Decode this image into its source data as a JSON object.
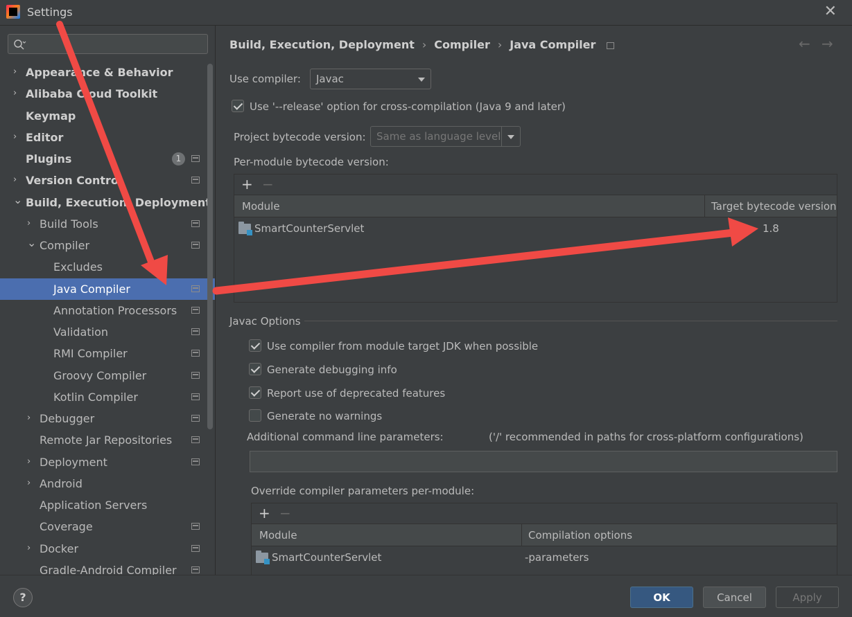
{
  "window": {
    "title": "Settings",
    "close_icon": "close-icon"
  },
  "sidebar": {
    "search_placeholder": "",
    "items": [
      {
        "label": "Appearance & Behavior",
        "bold": true,
        "arrow": "›"
      },
      {
        "label": "Alibaba Cloud Toolkit",
        "bold": true,
        "arrow": "›"
      },
      {
        "label": "Keymap",
        "bold": true,
        "arrow": ""
      },
      {
        "label": "Editor",
        "bold": true,
        "arrow": "›"
      },
      {
        "label": "Plugins",
        "bold": true,
        "arrow": "",
        "badge": "1"
      },
      {
        "label": "Version Control",
        "bold": true,
        "arrow": "›"
      },
      {
        "label": "Build, Execution, Deployment",
        "bold": true,
        "arrow": "⌄"
      },
      {
        "label": "Build Tools",
        "bold": false,
        "arrow": "›"
      },
      {
        "label": "Compiler",
        "bold": false,
        "arrow": "⌄"
      },
      {
        "label": "Excludes",
        "bold": false,
        "arrow": ""
      },
      {
        "label": "Java Compiler",
        "bold": false,
        "arrow": "",
        "selected": true
      },
      {
        "label": "Annotation Processors",
        "bold": false,
        "arrow": ""
      },
      {
        "label": "Validation",
        "bold": false,
        "arrow": ""
      },
      {
        "label": "RMI Compiler",
        "bold": false,
        "arrow": ""
      },
      {
        "label": "Groovy Compiler",
        "bold": false,
        "arrow": ""
      },
      {
        "label": "Kotlin Compiler",
        "bold": false,
        "arrow": ""
      },
      {
        "label": "Debugger",
        "bold": false,
        "arrow": "›"
      },
      {
        "label": "Remote Jar Repositories",
        "bold": false,
        "arrow": ""
      },
      {
        "label": "Deployment",
        "bold": false,
        "arrow": "›"
      },
      {
        "label": "Android",
        "bold": false,
        "arrow": "›"
      },
      {
        "label": "Application Servers",
        "bold": false,
        "arrow": ""
      },
      {
        "label": "Coverage",
        "bold": false,
        "arrow": ""
      },
      {
        "label": "Docker",
        "bold": false,
        "arrow": "›"
      },
      {
        "label": "Gradle-Android Compiler",
        "bold": false,
        "arrow": ""
      }
    ]
  },
  "breadcrumb": {
    "part1": "Build, Execution, Deployment",
    "part2": "Compiler",
    "part3": "Java Compiler",
    "sep": "›"
  },
  "nav": {
    "back": "←",
    "forward": "→"
  },
  "compiler": {
    "use_compiler_label": "Use compiler:",
    "use_compiler_value": "Javac",
    "release_option_label": "Use '--release' option for cross-compilation (Java 9 and later)",
    "release_option_checked": true,
    "project_bytecode_label": "Project bytecode version:",
    "project_bytecode_value": "Same as language level",
    "per_module_label": "Per-module bytecode version:"
  },
  "module_table": {
    "add": "+",
    "remove": "−",
    "headers": [
      "Module",
      "Target bytecode version"
    ],
    "rows": [
      {
        "module": "SmartCounterServlet",
        "target": "1.8"
      }
    ]
  },
  "javac": {
    "section_title": "Javac Options",
    "options": [
      {
        "label": "Use compiler from module target JDK when possible",
        "checked": true
      },
      {
        "label": "Generate debugging info",
        "checked": true
      },
      {
        "label": "Report use of deprecated features",
        "checked": true
      },
      {
        "label": "Generate no warnings",
        "checked": false
      }
    ],
    "additional_params_label": "Additional command line parameters:",
    "additional_params_hint": "('/' recommended in paths for cross-platform configurations)",
    "additional_params_value": "",
    "override_label": "Override compiler parameters per-module:"
  },
  "override_table": {
    "add": "+",
    "remove": "−",
    "headers": [
      "Module",
      "Compilation options"
    ],
    "rows": [
      {
        "module": "SmartCounterServlet",
        "options": "-parameters"
      }
    ]
  },
  "footer": {
    "help": "?",
    "ok": "OK",
    "cancel": "Cancel",
    "apply": "Apply"
  },
  "colors": {
    "selection": "#4b6eaf",
    "primary_button": "#365880",
    "annotation_arrow": "#f04a45"
  }
}
